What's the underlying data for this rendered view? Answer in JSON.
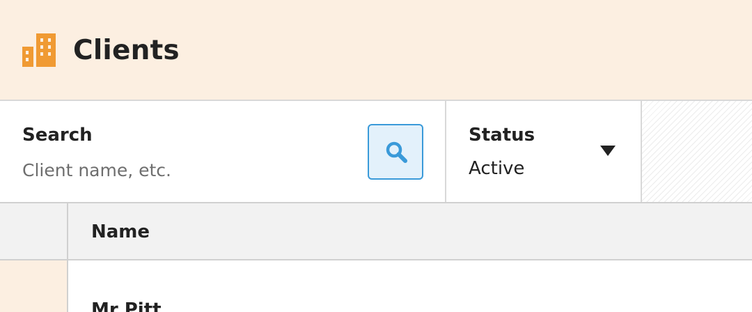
{
  "header": {
    "title": "Clients",
    "icon": "building-icon",
    "icon_color": "#f09a33",
    "background": "#fcefe1"
  },
  "filters": {
    "search": {
      "label": "Search",
      "placeholder": "Client name, etc.",
      "value": "",
      "button_icon": "search-icon",
      "accent": "#3a9ad9"
    },
    "status": {
      "label": "Status",
      "value": "Active",
      "icon": "caret-down-icon"
    }
  },
  "table": {
    "columns": [
      "Name"
    ],
    "rows": [
      {
        "name": "Mr Pitt"
      }
    ]
  }
}
